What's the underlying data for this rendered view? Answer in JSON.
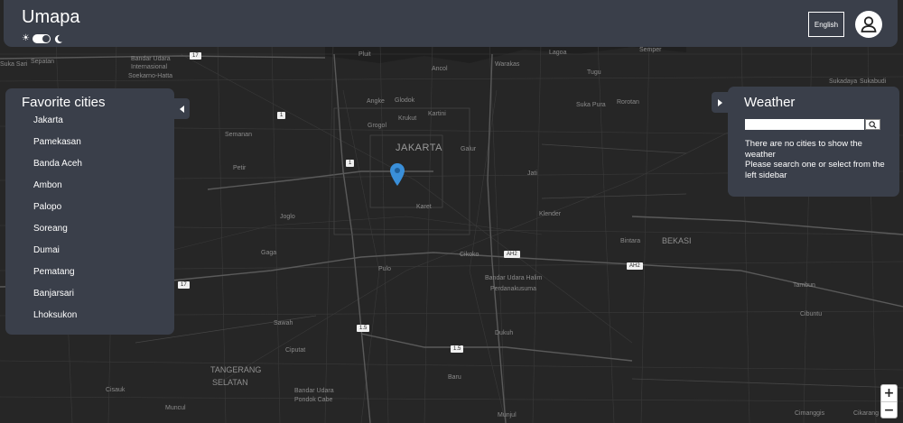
{
  "header": {
    "app_title": "Umapa",
    "theme": {
      "sun_icon": "sun-icon",
      "moon_icon": "moon-icon",
      "mode": "dark"
    },
    "language_button": "English",
    "user_icon": "user-icon"
  },
  "favorites": {
    "title": "Favorite cities",
    "cities": [
      "Jakarta",
      "Pamekasan",
      "Banda Aceh",
      "Ambon",
      "Palopo",
      "Soreang",
      "Dumai",
      "Pematang",
      "Banjarsari",
      "Lhoksukon"
    ],
    "collapse_icon": "chevron-left-icon"
  },
  "weather": {
    "title": "Weather",
    "search_value": "",
    "search_icon": "search-icon",
    "message_line1": "There are no cities to show the weather",
    "message_line2": "Please search one or select from the left sidebar",
    "expand_icon": "chevron-right-icon"
  },
  "map": {
    "labels": {
      "pluit": "Pluit",
      "suka_sari": "Suka Sari",
      "sepatan": "Sepatan",
      "bandar_udara_1": "Bandar Udara",
      "internasional": "Internasional",
      "soekarno_hatta": "Soekarno-Hatta",
      "ancol": "Ancol",
      "warakas": "Warakas",
      "lagoa": "Lagoa",
      "tugu": "Tugu",
      "semper": "Semper",
      "sukadaya": "Sukadaya",
      "sukabudi": "Sukabudi",
      "angke": "Angke",
      "glodok": "Glodok",
      "krukut": "Krukut",
      "kartini": "Kartini",
      "suka_pura": "Suka Pura",
      "rorotan": "Rorotan",
      "grogol": "Grogol",
      "semanan": "Semanan",
      "jakarta": "JAKARTA",
      "galur": "Galur",
      "petir": "Petir",
      "jati": "Jati",
      "joglo": "Joglo",
      "karet": "Karet",
      "klender": "Klender",
      "bintara": "Bintara",
      "bekasi": "BEKASI",
      "gaga": "Gaga",
      "cikoko": "Cikoko",
      "pulo": "Pulo",
      "bandar_udara_halim": "Bandar Udara Halim",
      "perdanakusuma": "Perdanakusuma",
      "tambun": "Tambun",
      "sawah": "Sawah",
      "cibuntu": "Cibuntu",
      "ciputat": "Ciputat",
      "dukuh": "Dukuh",
      "tangerang": "TANGERANG",
      "selatan": "SELATAN",
      "baru": "Baru",
      "cisauk": "Cisauk",
      "bandar_udara_2": "Bandar Udara",
      "pondok_cabe": "Pondok Cabe",
      "muncul": "Muncul",
      "munjul": "Munjul",
      "cimanggis": "Cimanggis",
      "cikarang": "Cikarang"
    },
    "shields": {
      "s17a": "17",
      "s1a": "1",
      "s1b": "1",
      "sah2a": "AH2",
      "sah2b": "AH2",
      "s17b": "17",
      "s15a": "1.5",
      "s15b": "1.5"
    },
    "marker_icon": "location-pin-icon",
    "zoom_in": "+",
    "zoom_out": "−"
  }
}
